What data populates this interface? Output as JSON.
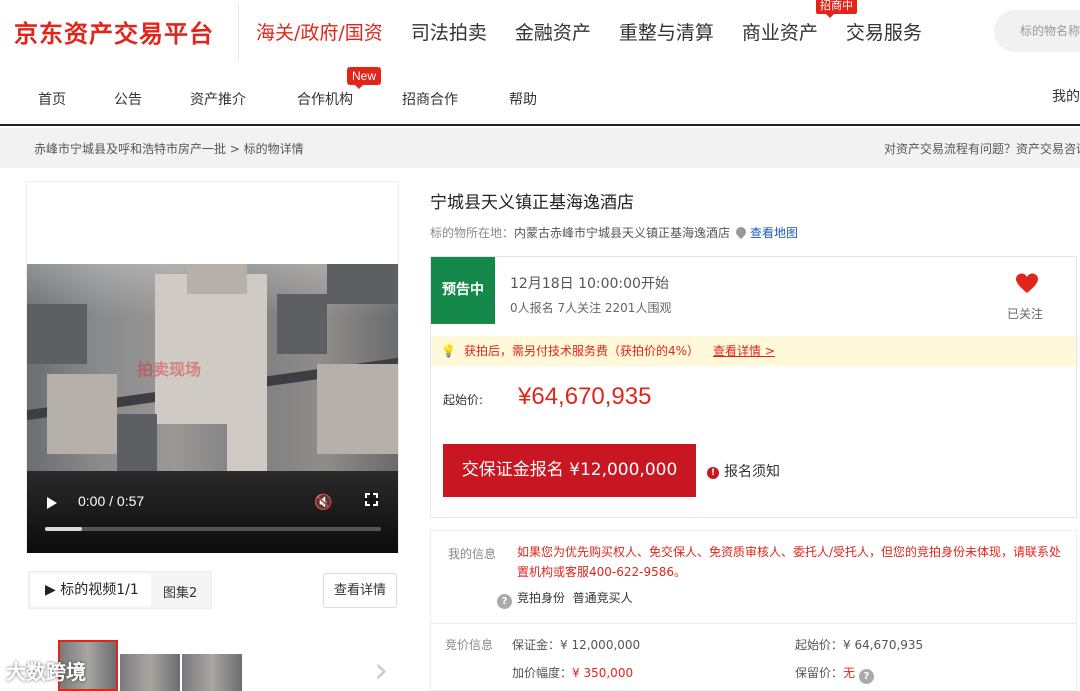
{
  "header": {
    "logo": "京东资产交易平台",
    "nav": [
      "海关/政府/国资",
      "司法拍卖",
      "金融资产",
      "重整与清算",
      "商业资产",
      "交易服务"
    ],
    "active_index": 0,
    "recruit_badge": "招商中",
    "search_placeholder": "标的物名称"
  },
  "subnav": {
    "items": [
      "首页",
      "公告",
      "资产推介",
      "合作机构",
      "招商合作",
      "帮助"
    ],
    "new_badge": "New",
    "mine": "我的"
  },
  "breadcrumb": {
    "path": "赤峰市宁城县及呼和浩特市房产一批  >  标的物详情",
    "help": "对资产交易流程有问题？资产交易咨询"
  },
  "media": {
    "watermark": "拍卖现场",
    "time": "0:00 / 0:57",
    "progress": 0.11,
    "tab_video": "▶ 标的视频1/1",
    "tab_gallery": "图集2",
    "detail_button": "查看详情",
    "brand_watermark": "大数跨境"
  },
  "item": {
    "title": "宁城县天义镇正基海逸酒店",
    "location_label": "标的物所在地：",
    "address": "内蒙古赤峰市宁城县天义镇正基海逸酒店",
    "map_link": "查看地图"
  },
  "auction": {
    "status": "预告中",
    "start_time": "12月18日 10:00:00开始",
    "stats": "0人报名  7人关注  2201人围观",
    "followed": "已关注",
    "notice": "获拍后，需另付技术服务费（获拍价的4%）",
    "notice_link": "查看详情 >",
    "start_label": "起始价:",
    "start_price": "¥64,670,935",
    "deposit_button": "交保证金报名 ¥12,000,000",
    "reg_notice": "报名须知"
  },
  "my_info": {
    "label": "我的信息",
    "message": "如果您为优先购买权人、免交保人、免资质审核人、委托人/受托人，但您的竞拍身份未体现，请联系处置机构或客服400-622-9586。",
    "identity_label": "竞拍身份",
    "identity_value": "普通竞买人"
  },
  "bid_info": {
    "label": "竞价信息",
    "deposit_label": "保证金：",
    "deposit_value": "¥ 12,000,000",
    "start_label": "起始价：",
    "start_value": "¥ 64,670,935",
    "increment_label": "加价幅度：",
    "increment_value": "¥ 350,000",
    "reserve_label": "保留价：",
    "reserve_value": "无"
  },
  "colors": {
    "brand_red": "#e1251b",
    "status_green": "#14894a",
    "button_red": "#c81623"
  }
}
